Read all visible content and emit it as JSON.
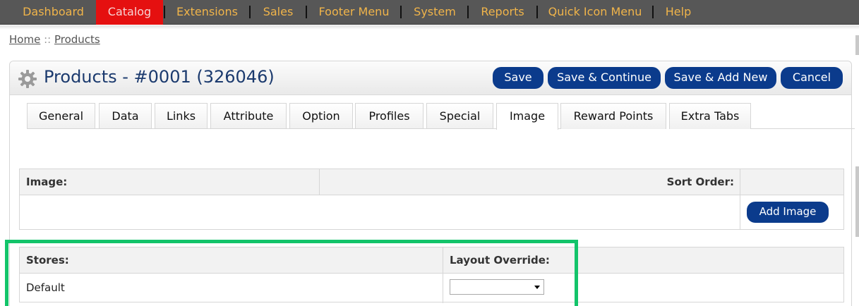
{
  "nav": {
    "items": [
      {
        "label": "Dashboard",
        "active": false
      },
      {
        "label": "Catalog",
        "active": true
      },
      {
        "label": "Extensions",
        "active": false
      },
      {
        "label": "Sales",
        "active": false
      },
      {
        "label": "Footer Menu",
        "active": false
      },
      {
        "label": "System",
        "active": false
      },
      {
        "label": "Reports",
        "active": false
      },
      {
        "label": "Quick Icon Menu",
        "active": false
      },
      {
        "label": "Help",
        "active": false
      }
    ]
  },
  "breadcrumb": {
    "home": "Home",
    "separator": "::",
    "current": "Products"
  },
  "heading": {
    "title": "Products - #0001 (326046)",
    "icon": "gear-icon",
    "buttons": {
      "save": "Save",
      "save_continue": "Save & Continue",
      "save_add_new": "Save & Add New",
      "cancel": "Cancel"
    }
  },
  "tabs": [
    {
      "label": "General",
      "active": false
    },
    {
      "label": "Data",
      "active": false
    },
    {
      "label": "Links",
      "active": false
    },
    {
      "label": "Attribute",
      "active": false
    },
    {
      "label": "Option",
      "active": false
    },
    {
      "label": "Profiles",
      "active": false
    },
    {
      "label": "Special",
      "active": false
    },
    {
      "label": "Image",
      "active": true
    },
    {
      "label": "Reward Points",
      "active": false
    },
    {
      "label": "Extra Tabs",
      "active": false
    }
  ],
  "image_table": {
    "col_image": "Image:",
    "col_sort": "Sort Order:",
    "add_button": "Add Image"
  },
  "layout_table": {
    "col_stores": "Stores:",
    "col_layout": "Layout Override:",
    "rows": [
      {
        "store": "Default",
        "layout": ""
      }
    ]
  },
  "colors": {
    "nav_bg": "#575757",
    "nav_text": "#f0b44a",
    "nav_active": "#e51010",
    "button": "#0b3b8c",
    "title": "#1b3a6e",
    "highlight": "#13c46a"
  }
}
